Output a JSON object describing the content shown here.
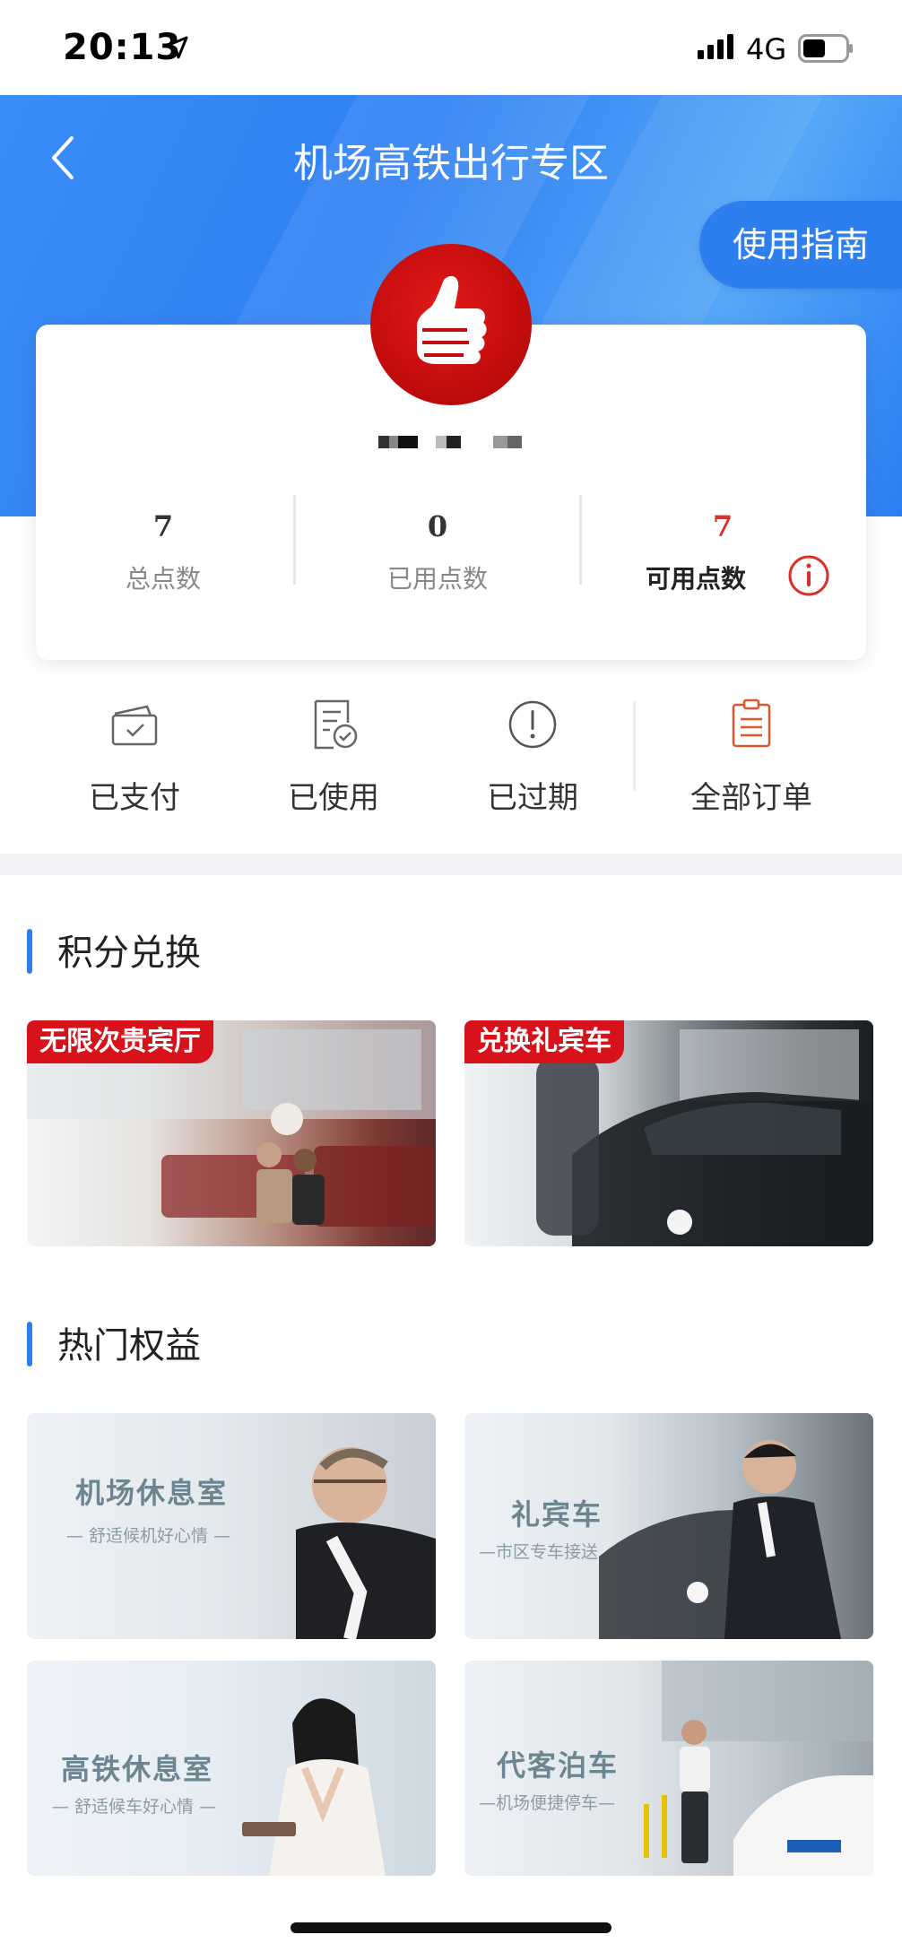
{
  "status_bar": {
    "time": "20:13",
    "network": "4G"
  },
  "header": {
    "title": "机场高铁出行专区",
    "guide_button": "使用指南"
  },
  "stats": [
    {
      "value": "7",
      "label": "总点数"
    },
    {
      "value": "0",
      "label": "已用点数"
    },
    {
      "value": "7",
      "label": "可用点数"
    }
  ],
  "orders": [
    {
      "label": "已支付",
      "icon": "paid-icon"
    },
    {
      "label": "已使用",
      "icon": "used-icon"
    },
    {
      "label": "已过期",
      "icon": "expired-icon"
    },
    {
      "label": "全部订单",
      "icon": "all-orders-icon"
    }
  ],
  "exchange": {
    "title": "积分兑换",
    "items": [
      {
        "tag": "无限次贵宾厅"
      },
      {
        "tag": "兑换礼宾车"
      }
    ]
  },
  "hot": {
    "title": "热门权益",
    "items": [
      {
        "title": "机场休息室",
        "subtitle": "— 舒适候机好心情 —"
      },
      {
        "title": "礼宾车",
        "subtitle": "—市区专车接送"
      },
      {
        "title": "高铁休息室",
        "subtitle": "— 舒适候车好心情 —"
      },
      {
        "title": "代客泊车",
        "subtitle": "—机场便捷停车—"
      }
    ]
  },
  "colors": {
    "primary": "#2d7ff0",
    "accent_red": "#d9302b",
    "tag_red": "#d7121b"
  }
}
